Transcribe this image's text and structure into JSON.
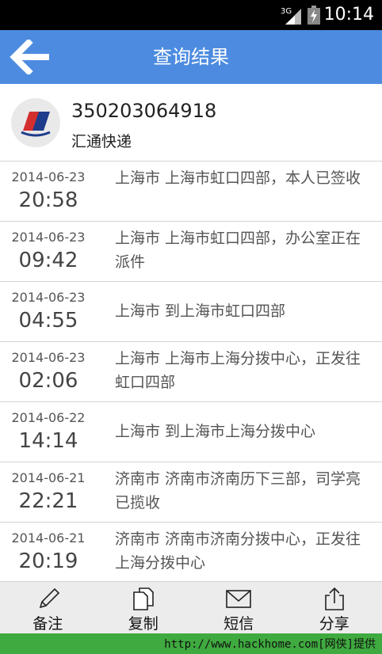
{
  "status_bar": {
    "network": "3G",
    "time": "10:14"
  },
  "title_bar": {
    "title": "查询结果",
    "back_icon": "arrow-left-icon"
  },
  "shipment": {
    "tracking_number": "350203064918",
    "carrier": "汇通快递",
    "logo_icon": "carrier-logo-icon"
  },
  "events": [
    {
      "date": "2014-06-23",
      "time": "20:58",
      "description": "上海市 上海市虹口四部，本人已签收"
    },
    {
      "date": "2014-06-23",
      "time": "09:42",
      "description": "上海市 上海市虹口四部，办公室正在派件"
    },
    {
      "date": "2014-06-23",
      "time": "04:55",
      "description": "上海市 到上海市虹口四部"
    },
    {
      "date": "2014-06-23",
      "time": "02:06",
      "description": "上海市 上海市上海分拨中心，正发往虹口四部"
    },
    {
      "date": "2014-06-22",
      "time": "14:14",
      "description": "上海市 到上海市上海分拨中心"
    },
    {
      "date": "2014-06-21",
      "time": "22:21",
      "description": "济南市 济南市济南历下三部，司学亮已揽收"
    },
    {
      "date": "2014-06-21",
      "time": "20:19",
      "description": "济南市 济南市济南分拨中心，正发往上海分拨中心"
    }
  ],
  "actions": [
    {
      "label": "备注",
      "icon": "pencil-icon"
    },
    {
      "label": "复制",
      "icon": "copy-icon"
    },
    {
      "label": "短信",
      "icon": "envelope-icon"
    },
    {
      "label": "分享",
      "icon": "share-icon"
    }
  ],
  "watermark": "http://www.hackhome.com[网侠]提供",
  "colors": {
    "title_bar": "#4c8be0",
    "bottom_bar": "#ececec",
    "watermark_bar": "#3faa3f"
  }
}
